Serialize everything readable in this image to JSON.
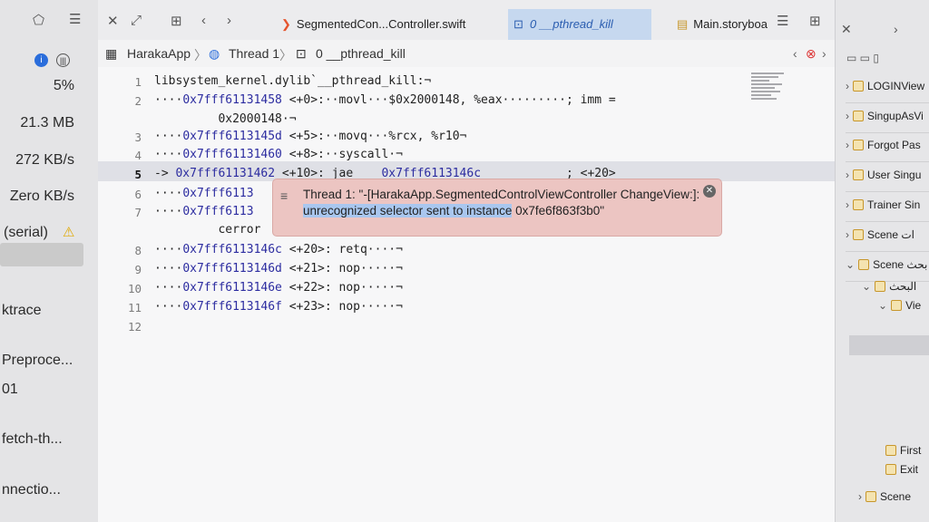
{
  "left": {
    "values": [
      "5%",
      "21.3 MB",
      "272 KB/s",
      "Zero KB/s",
      "(serial)"
    ],
    "items": [
      "ktrace",
      "Preproce...",
      "01",
      "fetch-th...",
      "nnectio..."
    ]
  },
  "tabs": [
    {
      "label": "SegmentedCon...Controller.swift"
    },
    {
      "label": "0 __pthread_kill"
    },
    {
      "label": "Main.storyboa"
    }
  ],
  "breadcrumb": {
    "project": "HarakaApp",
    "thread": "Thread 1",
    "frame": "0 __pthread_kill"
  },
  "code_lines": [
    {
      "n": "1",
      "text": "libsystem_kernel.dylib`__pthread_kill:¬"
    },
    {
      "n": "2",
      "text": "····0x7fff61131458 <+0>:··movl···$0x2000148, %eax·········; imm ="
    },
    {
      "n": "",
      "text": "         0x2000148·¬"
    },
    {
      "n": "3",
      "text": "····0x7fff6113145d <+5>:··movq···%rcx, %r10¬"
    },
    {
      "n": "4",
      "text": "····0x7fff61131460 <+8>:··syscall·¬"
    },
    {
      "n": "5",
      "text": "-> 0x7fff61131462 <+10>: jae    0x7fff6113146c            ; <+20>"
    },
    {
      "n": "6",
      "text": "····0x7fff6113"
    },
    {
      "n": "7",
      "text": "····0x7fff6113"
    },
    {
      "n": "",
      "text": "         cerror"
    },
    {
      "n": "8",
      "text": "····0x7fff6113146c <+20>: retq····¬"
    },
    {
      "n": "9",
      "text": "····0x7fff6113146d <+21>: nop·····¬"
    },
    {
      "n": "10",
      "text": "····0x7fff6113146e <+22>: nop·····¬"
    },
    {
      "n": "11",
      "text": "····0x7fff6113146f <+23>: nop·····¬"
    },
    {
      "n": "12",
      "text": ""
    }
  ],
  "error": {
    "prefix": "Thread 1: \"-[HarakaApp.SegmentedControlViewController ChangeView:]: ",
    "selected": "unrecognized selector sent to instance",
    "suffix": " 0x7fe6f863f3b0\""
  },
  "outline": [
    {
      "label": "LOGINView"
    },
    {
      "label": "SingupAsVi"
    },
    {
      "label": "Forgot Pas"
    },
    {
      "label": "User Singu"
    },
    {
      "label": "Trainer Sin"
    },
    {
      "label": "Scene ات"
    },
    {
      "label": "Scene بحث"
    },
    {
      "label": "البحث"
    },
    {
      "label": "Vie"
    },
    {
      "label": "First"
    },
    {
      "label": "Exit"
    },
    {
      "label": "Scene"
    }
  ],
  "colors": {
    "error_bg": "#ecc5c2",
    "selection": "#a9c7ef",
    "active_tab": "#c6d8ef"
  }
}
